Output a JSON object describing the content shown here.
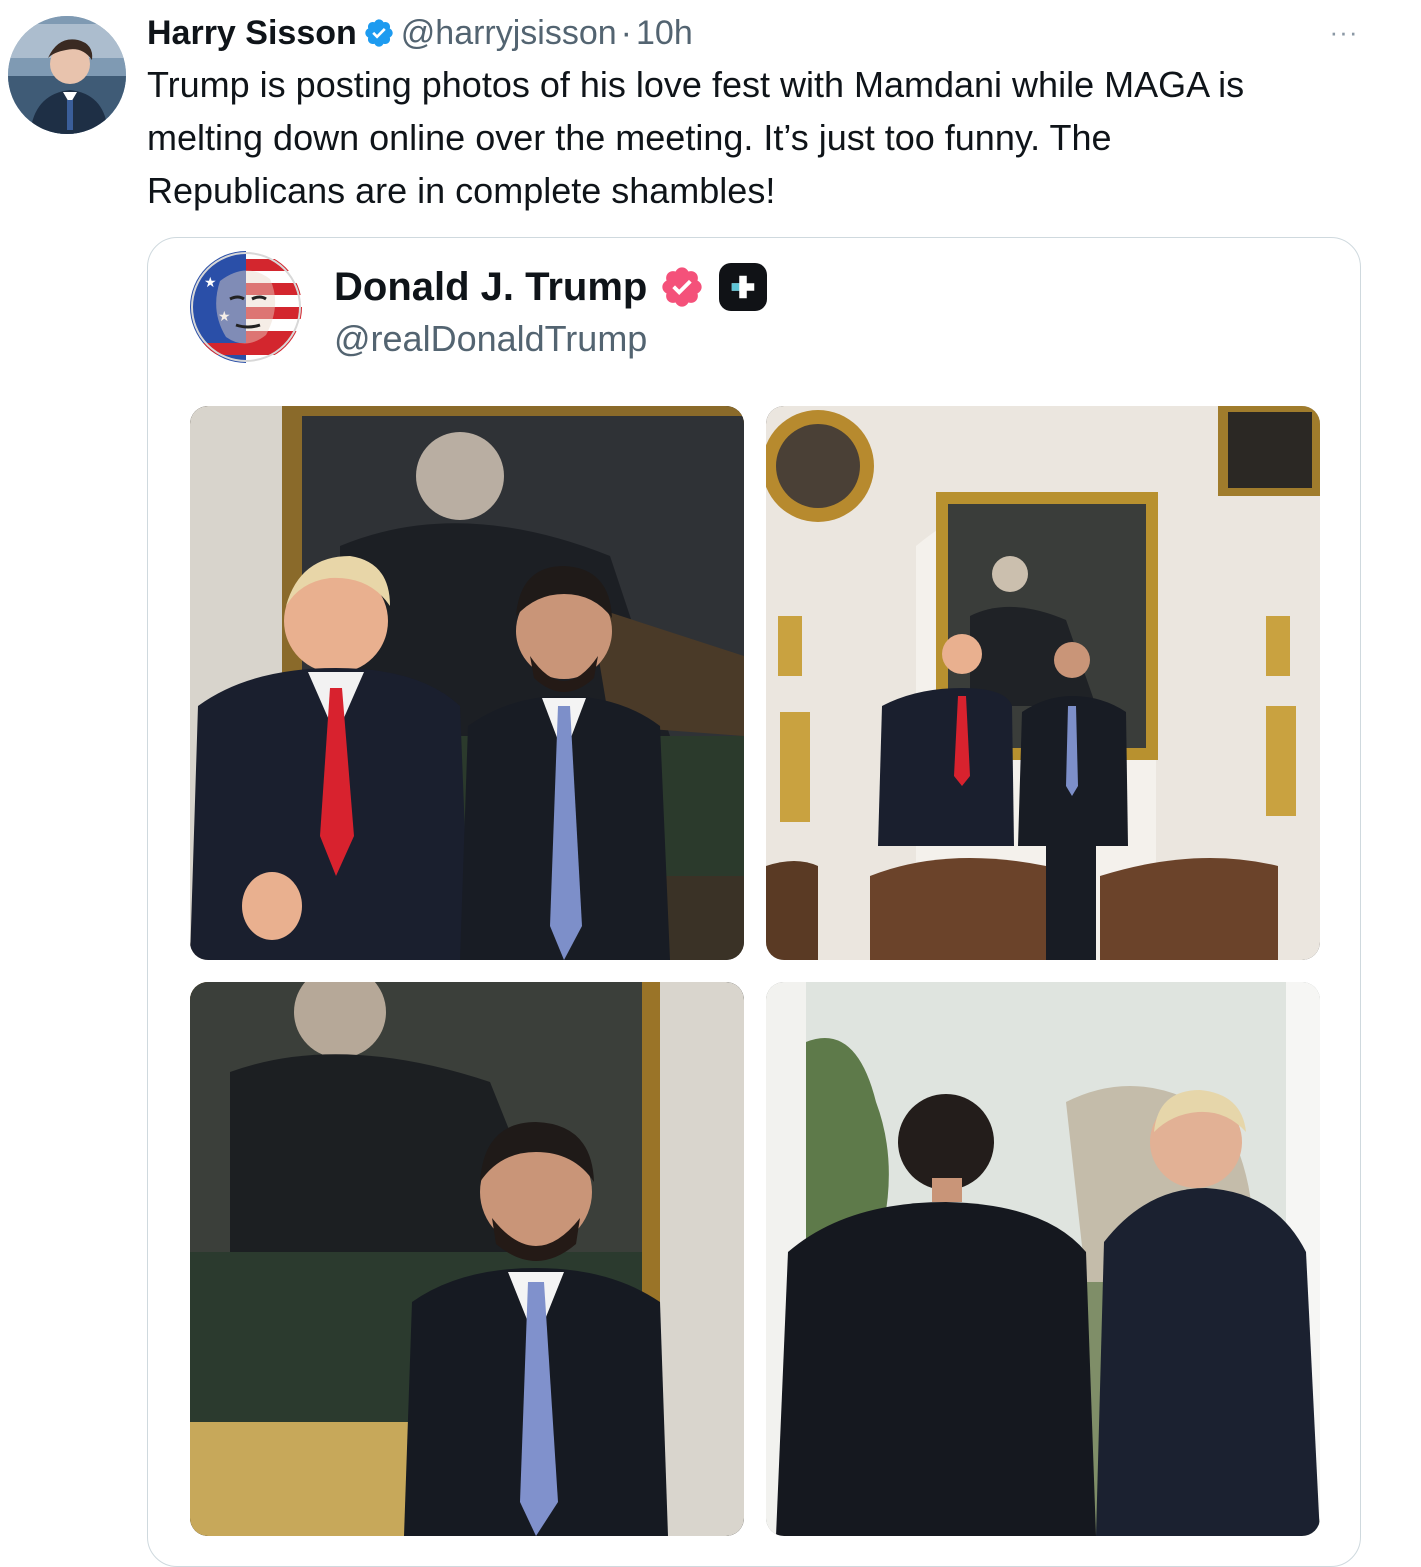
{
  "tweet": {
    "author_name": "Harry Sisson",
    "handle": "@harryjsisson",
    "separator": "·",
    "time": "10h",
    "more_label": "···",
    "text": "Trump is posting photos of his love fest with Mamdani while MAGA is\nmelting down online over the meeting. It’s just too funny. The\nRepublicans are in complete shambles!"
  },
  "embedded_post": {
    "author_name": "Donald J. Trump",
    "handle": "@realDonaldTrump",
    "photos": [
      {
        "description_icon": "photo-two-men-portrait"
      },
      {
        "description_icon": "photo-room-wide"
      },
      {
        "description_icon": "photo-man-portrait"
      },
      {
        "description_icon": "photo-two-men-window"
      }
    ]
  },
  "colors": {
    "text_primary": "#0f1419",
    "text_secondary": "#536471",
    "verified_blue": "#1d9bf0",
    "verified_pink": "#f4517a",
    "card_border": "#cfd9de"
  }
}
